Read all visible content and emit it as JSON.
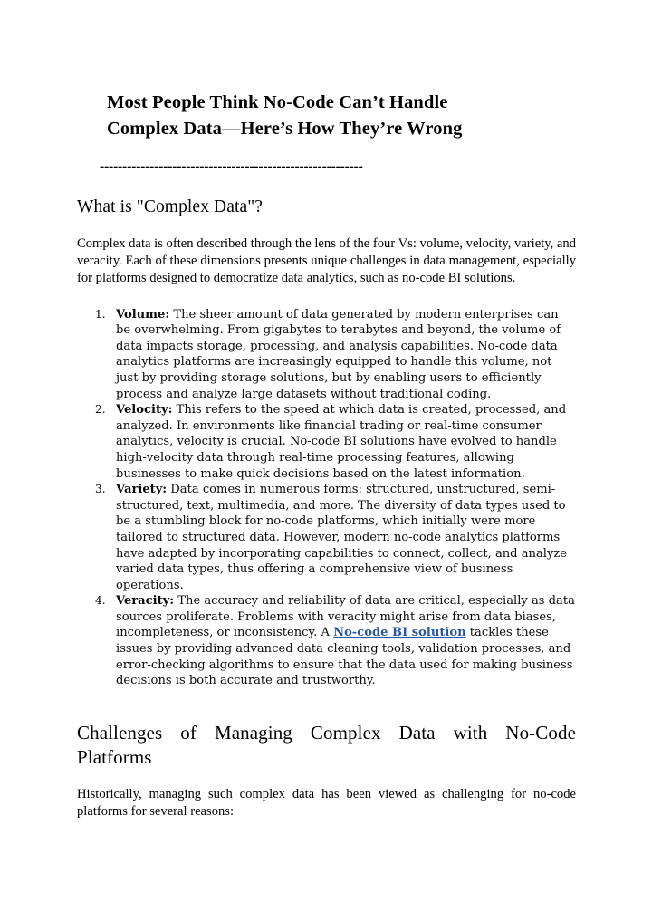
{
  "document": {
    "title_line1": "Most People Think No-Code Can’t Handle",
    "title_line2": "Complex Data—Here’s How They’re Wrong",
    "divider": "----------------------------------------------------------",
    "section1": {
      "heading": "What is \"Complex Data\"?",
      "paragraph": "Complex data is often described through the lens of the four Vs: volume, velocity, variety, and veracity. Each of these dimensions presents unique challenges in data management, especially for platforms designed to democratize data analytics, such as no-code BI solutions.",
      "list": [
        {
          "number": "1.",
          "term": "Volume:",
          "text": " The sheer amount of data generated by modern enterprises can be overwhelming. From gigabytes to terabytes and beyond, the volume of data impacts storage, processing, and analysis capabilities. No-code data analytics platforms are increasingly equipped to handle this volume, not just by providing storage solutions, but by enabling users to efficiently process and analyze large datasets without traditional coding."
        },
        {
          "number": "2.",
          "term": "Velocity:",
          "text": " This refers to the speed at which data is created, processed, and analyzed. In environments like financial trading or real-time consumer analytics, velocity is crucial. No-code BI solutions have evolved to handle high-velocity data through real-time processing features, allowing businesses to make quick decisions based on the latest information."
        },
        {
          "number": "3.",
          "term": "Variety:",
          "text": " Data comes in numerous forms: structured, unstructured, semi-structured, text, multimedia, and more. The diversity of data types used to be a stumbling block for no-code platforms, which initially were more tailored to structured data. However, modern no-code analytics platforms have adapted by incorporating capabilities to connect, collect, and analyze varied data types, thus offering a comprehensive view of business operations."
        },
        {
          "number": "4.",
          "term": "Veracity:",
          "text_before_link": " The accuracy and reliability of data are critical, especially as data sources proliferate. Problems with veracity might arise from data biases, incompleteness, or inconsistency. A ",
          "link_text": "No-code BI solution",
          "text_after_link": " tackles these issues by providing advanced data cleaning tools, validation processes, and error-checking algorithms to ensure that the data used for making business decisions is both accurate and trustworthy."
        }
      ]
    },
    "section2": {
      "heading": "Challenges of Managing Complex Data with No-Code Platforms",
      "paragraph": "Historically, managing such complex data has been viewed as challenging for no-code platforms for several reasons:"
    },
    "colors": {
      "text": "#000000",
      "link": "#2a56a8",
      "background": "#ffffff"
    }
  }
}
